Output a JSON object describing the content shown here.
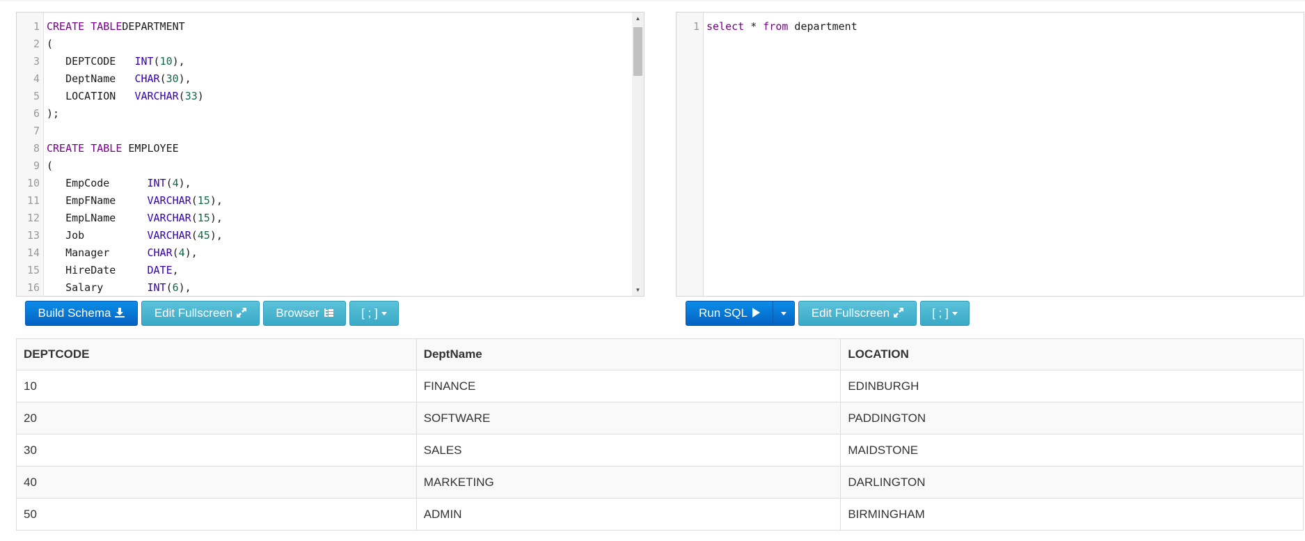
{
  "schema_editor": {
    "lines": [
      {
        "n": "1",
        "tokens": [
          [
            "kw",
            "CREATE TABLE"
          ],
          [
            "",
            "DEPARTMENT"
          ]
        ]
      },
      {
        "n": "2",
        "tokens": [
          [
            "",
            "("
          ]
        ]
      },
      {
        "n": "3",
        "tokens": [
          [
            "",
            "   DEPTCODE   "
          ],
          [
            "ty",
            "INT"
          ],
          [
            "",
            "("
          ],
          [
            "num",
            "10"
          ],
          [
            "",
            "),"
          ]
        ]
      },
      {
        "n": "4",
        "tokens": [
          [
            "",
            "   DeptName   "
          ],
          [
            "ty",
            "CHAR"
          ],
          [
            "",
            "("
          ],
          [
            "num",
            "30"
          ],
          [
            "",
            "),"
          ]
        ]
      },
      {
        "n": "5",
        "tokens": [
          [
            "",
            "   LOCATION   "
          ],
          [
            "ty",
            "VARCHAR"
          ],
          [
            "",
            "("
          ],
          [
            "num",
            "33"
          ],
          [
            "",
            ")"
          ]
        ]
      },
      {
        "n": "6",
        "tokens": [
          [
            "",
            ");"
          ]
        ]
      },
      {
        "n": "7",
        "tokens": []
      },
      {
        "n": "8",
        "tokens": [
          [
            "kw",
            "CREATE TABLE"
          ],
          [
            "",
            " EMPLOYEE"
          ]
        ]
      },
      {
        "n": "9",
        "tokens": [
          [
            "",
            "("
          ]
        ]
      },
      {
        "n": "10",
        "tokens": [
          [
            "",
            "   EmpCode      "
          ],
          [
            "ty",
            "INT"
          ],
          [
            "",
            "("
          ],
          [
            "num",
            "4"
          ],
          [
            "",
            "),"
          ]
        ]
      },
      {
        "n": "11",
        "tokens": [
          [
            "",
            "   EmpFName     "
          ],
          [
            "ty",
            "VARCHAR"
          ],
          [
            "",
            "("
          ],
          [
            "num",
            "15"
          ],
          [
            "",
            "),"
          ]
        ]
      },
      {
        "n": "12",
        "tokens": [
          [
            "",
            "   EmpLName     "
          ],
          [
            "ty",
            "VARCHAR"
          ],
          [
            "",
            "("
          ],
          [
            "num",
            "15"
          ],
          [
            "",
            "),"
          ]
        ]
      },
      {
        "n": "13",
        "tokens": [
          [
            "",
            "   Job          "
          ],
          [
            "ty",
            "VARCHAR"
          ],
          [
            "",
            "("
          ],
          [
            "num",
            "45"
          ],
          [
            "",
            "),"
          ]
        ]
      },
      {
        "n": "14",
        "tokens": [
          [
            "",
            "   Manager      "
          ],
          [
            "ty",
            "CHAR"
          ],
          [
            "",
            "("
          ],
          [
            "num",
            "4"
          ],
          [
            "",
            "),"
          ]
        ]
      },
      {
        "n": "15",
        "tokens": [
          [
            "",
            "   HireDate     "
          ],
          [
            "ty",
            "DATE"
          ],
          [
            "",
            ","
          ]
        ]
      },
      {
        "n": "16",
        "tokens": [
          [
            "",
            "   Salary       "
          ],
          [
            "ty",
            "INT"
          ],
          [
            "",
            "("
          ],
          [
            "num",
            "6"
          ],
          [
            "",
            "),"
          ]
        ]
      }
    ]
  },
  "query_editor": {
    "lines": [
      {
        "n": "1",
        "tokens": [
          [
            "kw",
            "select"
          ],
          [
            "",
            " * "
          ],
          [
            "kw",
            "from"
          ],
          [
            "",
            " department"
          ]
        ]
      }
    ]
  },
  "buttons": {
    "build_schema": "Build Schema",
    "edit_fullscreen": "Edit Fullscreen",
    "browser": "Browser",
    "delimiter": "[ ; ]",
    "run_sql": "Run SQL"
  },
  "icons": {
    "build_schema": "download-icon",
    "edit_fullscreen": "expand-icon",
    "browser": "tree-icon",
    "run_sql": "play-icon",
    "dropdown": "caret-down-icon"
  },
  "results": {
    "columns": [
      "DEPTCODE",
      "DeptName",
      "LOCATION"
    ],
    "rows": [
      [
        "10",
        "FINANCE",
        "EDINBURGH"
      ],
      [
        "20",
        "SOFTWARE",
        "PADDINGTON"
      ],
      [
        "30",
        "SALES",
        "MAIDSTONE"
      ],
      [
        "40",
        "MARKETING",
        "DARLINGTON"
      ],
      [
        "50",
        "ADMIN",
        "BIRMINGHAM"
      ]
    ]
  },
  "colors": {
    "primary": "#0a7fd9",
    "info": "#4bb5d0",
    "keyword": "#770088",
    "type": "#3300aa",
    "number": "#116644"
  }
}
